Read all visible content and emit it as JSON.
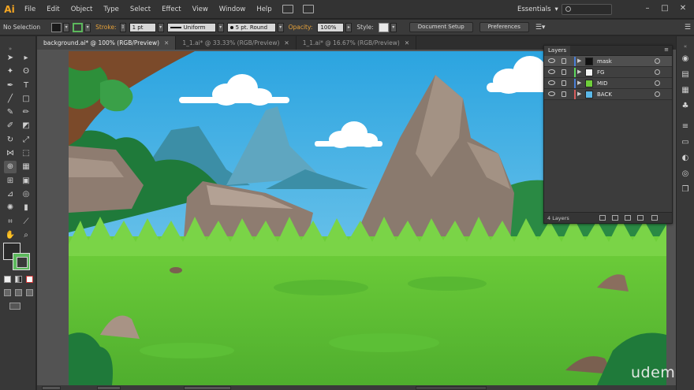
{
  "app": {
    "logo": "Ai",
    "menu": [
      "File",
      "Edit",
      "Object",
      "Type",
      "Select",
      "Effect",
      "View",
      "Window",
      "Help"
    ],
    "workspace": "Essentials",
    "workspace_arrow": "▾",
    "window_controls": [
      "–",
      "□",
      "✕"
    ]
  },
  "control_bar": {
    "selection": "No Selection",
    "stroke_label": "Stroke:",
    "stroke_weight": "1 pt",
    "profile": "Uniform",
    "brush": "5 pt. Round",
    "opacity_label": "Opacity:",
    "opacity": "100%",
    "style_label": "Style:",
    "document_setup": "Document Setup",
    "preferences": "Preferences",
    "fill_color": "#1a1a1a",
    "stroke_color": "#5cb85c"
  },
  "tabs": [
    {
      "label": "background.ai* @ 100% (RGB/Preview)",
      "active": true
    },
    {
      "label": "1_1.ai* @ 33.33% (RGB/Preview)",
      "active": false
    },
    {
      "label": "1_1.ai* @ 16.67% (RGB/Preview)",
      "active": false
    }
  ],
  "tab_close": "✕",
  "tools": {
    "icons": [
      "selection-icon",
      "direct-selection-icon",
      "magic-wand-icon",
      "lasso-icon",
      "pen-icon",
      "type-icon",
      "line-icon",
      "rectangle-icon",
      "paintbrush-icon",
      "pencil-icon",
      "blob-brush-icon",
      "eraser-icon",
      "rotate-icon",
      "scale-icon",
      "width-icon",
      "free-transform-icon",
      "shape-builder-icon",
      "perspective-icon",
      "mesh-icon",
      "gradient-icon",
      "eyedropper-icon",
      "blend-icon",
      "symbol-sprayer-icon",
      "column-graph-icon",
      "artboard-icon",
      "slice-icon",
      "hand-icon",
      "zoom-icon"
    ],
    "fill_color": "#2a2a2a",
    "stroke_color": "#5cb85c"
  },
  "layers_panel": {
    "title": "Layers",
    "layers": [
      {
        "name": "mask",
        "color": "#4a7fd6",
        "selected": true
      },
      {
        "name": "FG",
        "color": "#5cd65c",
        "selected": false
      },
      {
        "name": "MID",
        "color": "#4a7fd6",
        "selected": false
      },
      {
        "name": "BACK",
        "color": "#d65c5c",
        "selected": false
      }
    ],
    "count": "4 Layers"
  },
  "watermark": "udemy"
}
